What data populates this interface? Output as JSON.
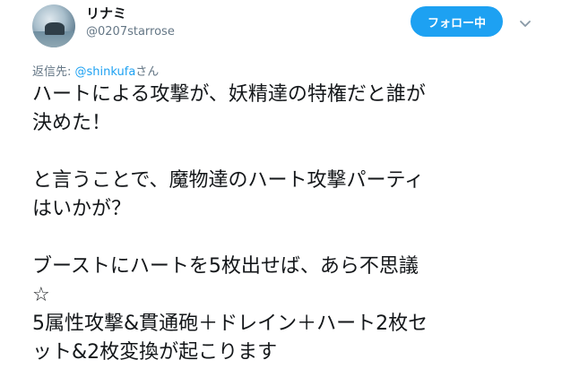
{
  "user": {
    "display_name": "リナミ",
    "screen_name": "@0207starrose"
  },
  "follow_button": {
    "label": "フォロー中"
  },
  "reply": {
    "prefix": "返信先: ",
    "handle": "@shinkufa",
    "suffix": "さん"
  },
  "tweet_lines": [
    "ハートによる攻撃が、妖精達の特権だと誰が",
    "決めた！",
    "",
    "と言うことで、魔物達のハート攻撃パーティ",
    "はいかが？",
    "",
    "ブーストにハートを5枚出せば、あら不思議",
    "☆",
    "5属性攻撃&貫通砲＋ドレイン＋ハート2枚セ",
    "ット&2枚変換が起こります"
  ],
  "icons": {
    "avatar": "avatar-image",
    "more": "chevron-down-icon"
  },
  "colors": {
    "accent": "#1da1f2",
    "secondary_text": "#657786",
    "primary_text": "#14171a"
  }
}
